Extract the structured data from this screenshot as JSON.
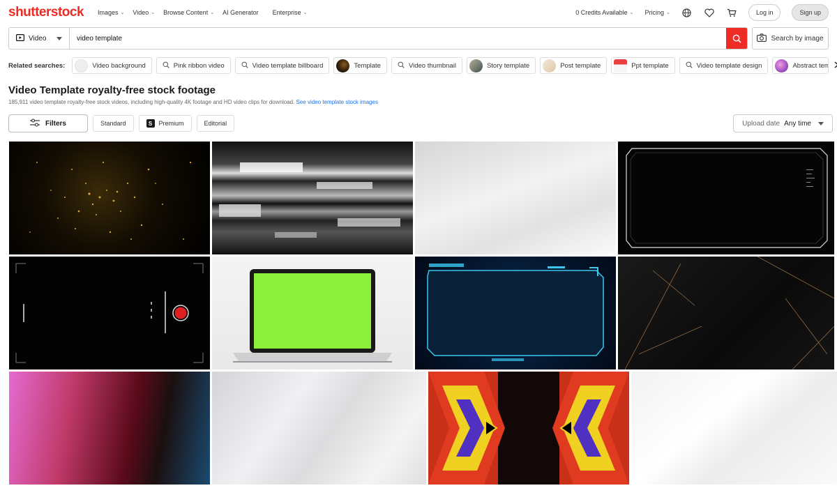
{
  "header": {
    "logo": "shutterstock",
    "nav": [
      {
        "label": "Images",
        "caret": true
      },
      {
        "label": "Video",
        "caret": true
      },
      {
        "label": "Browse Content",
        "caret": true
      },
      {
        "label": "AI Generator",
        "caret": false
      },
      {
        "label": "Enterprise",
        "caret": true
      }
    ],
    "credits": "0 Credits Available",
    "pricing": "Pricing",
    "login": "Log in",
    "signup": "Sign up"
  },
  "search": {
    "media_type": "Video",
    "query": "video template",
    "search_by_image": "Search by image"
  },
  "related": {
    "label": "Related searches:",
    "chips": [
      {
        "label": "Video background",
        "kind": "thumb",
        "color": "#eeeeee"
      },
      {
        "label": "Pink ribbon video",
        "kind": "search"
      },
      {
        "label": "Video template billboard",
        "kind": "search"
      },
      {
        "label": "Template",
        "kind": "thumb",
        "color": "#3a2a10"
      },
      {
        "label": "Video thumbnail",
        "kind": "search"
      },
      {
        "label": "Story template",
        "kind": "thumb",
        "color": "#9aa090"
      },
      {
        "label": "Post template",
        "kind": "thumb",
        "color": "#e8dcc8"
      },
      {
        "label": "Ppt template",
        "kind": "thumb",
        "color": "#e84040"
      },
      {
        "label": "Video template design",
        "kind": "search"
      },
      {
        "label": "Abstract temp",
        "kind": "thumb",
        "color": "#c070d0"
      }
    ]
  },
  "page": {
    "title": "Video Template royalty-free stock footage",
    "subtitle": "185,911 video template royalty-free stock videos, including high-quality 4K footage and HD video clips for download.",
    "subtitle_link": "See video template stock images"
  },
  "filters": {
    "filters_label": "Filters",
    "tabs": [
      "Standard",
      "Premium",
      "Editorial"
    ],
    "premium_badge": "S",
    "sort_label": "Upload date",
    "sort_value": "Any time"
  },
  "results": [
    {
      "name": "gold-particles-clip",
      "bg": "radial-gradient(circle at 45% 45%, #3a2a08 0%, #120c02 45%, #000 100%)"
    },
    {
      "name": "glitch-noise-clip",
      "bg": "linear-gradient(180deg,#111 0%,#444 20%,#ddd 28%,#222 35%,#bbb 48%,#111 55%,#999 62%,#222 70%,#555 80%,#111 100%)"
    },
    {
      "name": "white-gradient-clip",
      "bg": "linear-gradient(160deg,#d6d6d6 0%,#f2f2f2 45%,#e2e2e2 70%,#fafafa 100%)"
    },
    {
      "name": "hud-frame-clip",
      "bg": "#050505"
    },
    {
      "name": "camera-recording-clip",
      "bg": "#030303"
    },
    {
      "name": "laptop-green-screen-clip",
      "bg": "linear-gradient(180deg,#f4f4f4 0%,#e8e8e8 100%)"
    },
    {
      "name": "blue-hud-frame-clip",
      "bg": "radial-gradient(circle at 50% 50%, #0a2a50 0%, #041226 70%, #020a18 100%)"
    },
    {
      "name": "gold-lines-dark-clip",
      "bg": "linear-gradient(135deg,#1a1a1a 0%,#0a0a0a 60%,#151515 100%)"
    },
    {
      "name": "pink-blue-gradient-clip",
      "bg": "linear-gradient(100deg,#e46bd0 0%,#c03a6a 30%,#5a0a1a 60%,#1a1010 75%,#1a4a70 100%)"
    },
    {
      "name": "silver-abstract-clip",
      "bg": "linear-gradient(125deg,#d4d4d6 0%,#f0f0f2 35%,#dcdcde 55%,#f4f4f5 80%,#e0e0e2 100%)"
    },
    {
      "name": "kaleidoscope-tunnel-clip",
      "bg": "#1a0a0a"
    },
    {
      "name": "white-polygon-clip",
      "bg": "linear-gradient(140deg,#f2f2f2 0%,#ffffff 40%,#ececec 60%,#fafafa 100%)"
    }
  ]
}
